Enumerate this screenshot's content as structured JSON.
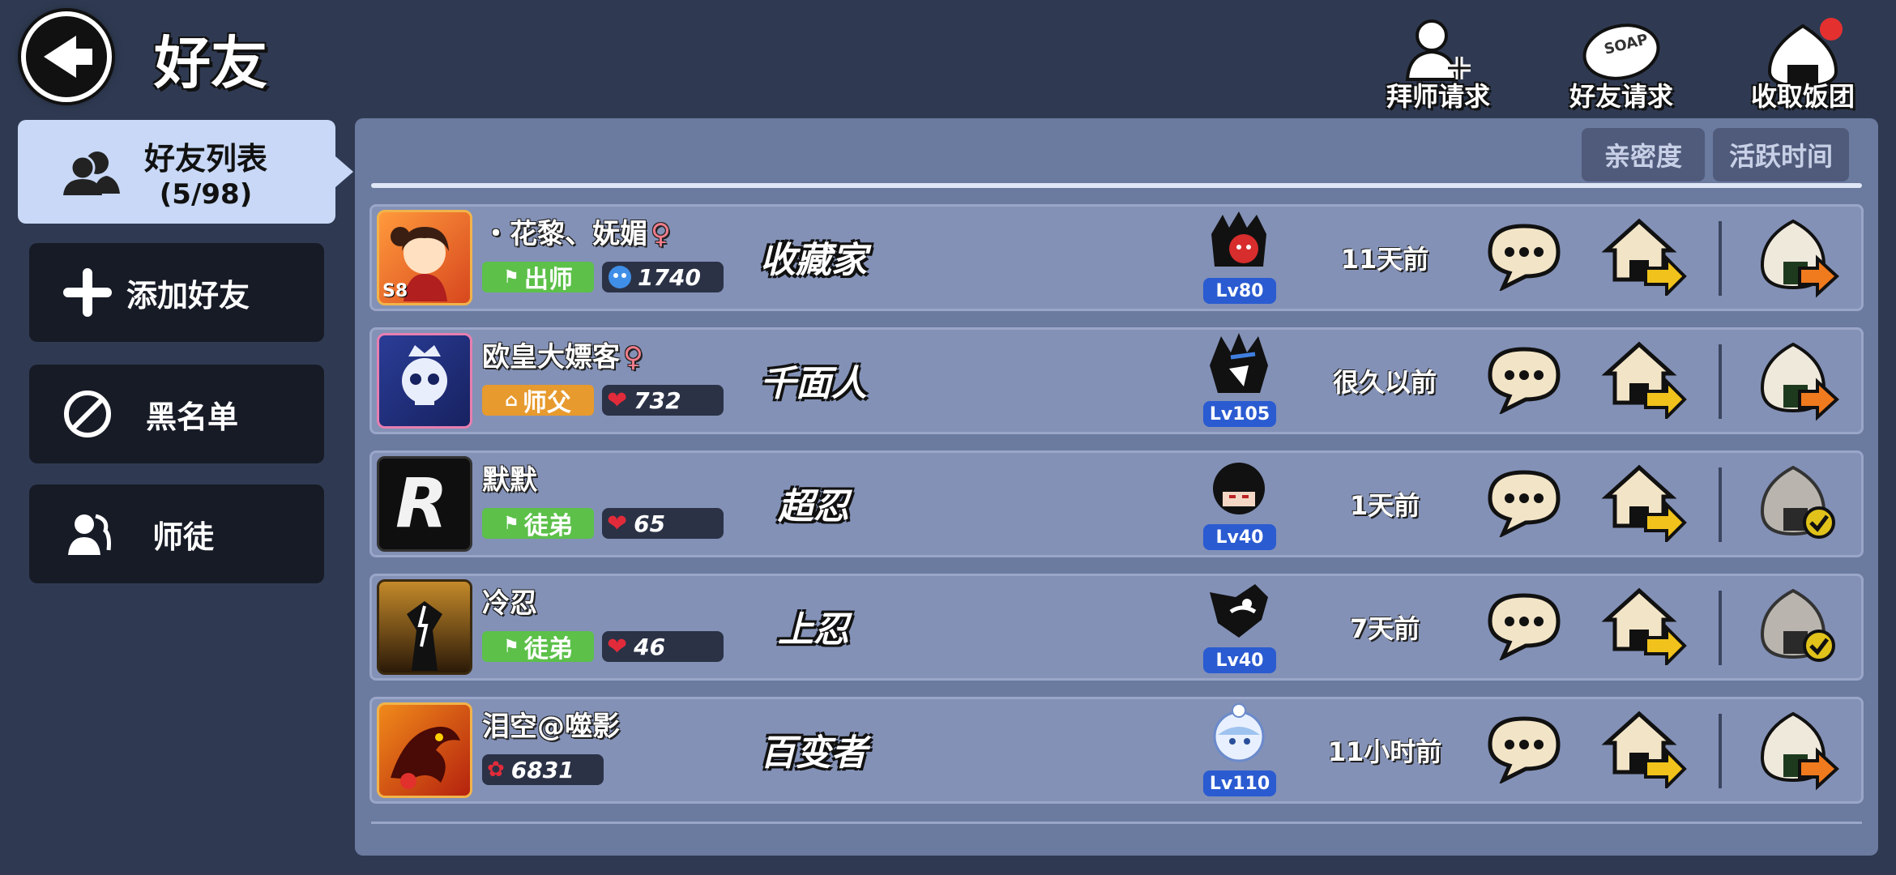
{
  "header": {
    "title": "好友",
    "actions": [
      {
        "label": "拜师请求",
        "icon": "add-master-icon"
      },
      {
        "label": "好友请求",
        "icon": "soap-bubble-icon",
        "icon_text": "SOAP"
      },
      {
        "label": "收取饭团",
        "icon": "onigiri-icon",
        "has_notification": true
      }
    ]
  },
  "sidebar": {
    "items": [
      {
        "label": "好友列表",
        "sublabel": "(5/98)",
        "selected": true,
        "icon": "friends-icon"
      },
      {
        "label": "添加好友",
        "icon": "plus-icon"
      },
      {
        "label": "黑名单",
        "icon": "block-icon"
      },
      {
        "label": "师徒",
        "icon": "mentor-icon"
      }
    ]
  },
  "sort_tabs": [
    "亲密度",
    "活跃时间"
  ],
  "friends": [
    {
      "name": "・花黎、妩媚",
      "gender": "♀",
      "role": "出师",
      "role_color": "#5cc049",
      "stat_type": "blue",
      "stat": "1740",
      "title": "收藏家",
      "level": "Lv80",
      "active": "11天前",
      "avatar_badge": "S8",
      "rice": "ready"
    },
    {
      "name": "欧皇大嫖客",
      "gender": "♀",
      "role": "师父",
      "role_color": "#e79a2d",
      "stat_type": "heart",
      "stat": "732",
      "title": "千面人",
      "level": "Lv105",
      "active": "很久以前",
      "rice": "ready"
    },
    {
      "name": "默默",
      "gender": "",
      "role": "徒弟",
      "role_color": "#5cc049",
      "stat_type": "heart",
      "stat": "65",
      "title": "超忍",
      "level": "Lv40",
      "active": "1天前",
      "avatar_letter": "R",
      "rice": "claimed"
    },
    {
      "name": "冷忍",
      "gender": "",
      "role": "徒弟",
      "role_color": "#5cc049",
      "stat_type": "heart",
      "stat": "46",
      "title": "上忍",
      "level": "Lv40",
      "active": "7天前",
      "rice": "claimed"
    },
    {
      "name": "泪空@噬影",
      "gender": "",
      "role": "",
      "role_color": "",
      "stat_type": "rose",
      "stat": "6831",
      "title": "百变者",
      "level": "Lv110",
      "active": "11小时前",
      "rice": "ready"
    }
  ]
}
